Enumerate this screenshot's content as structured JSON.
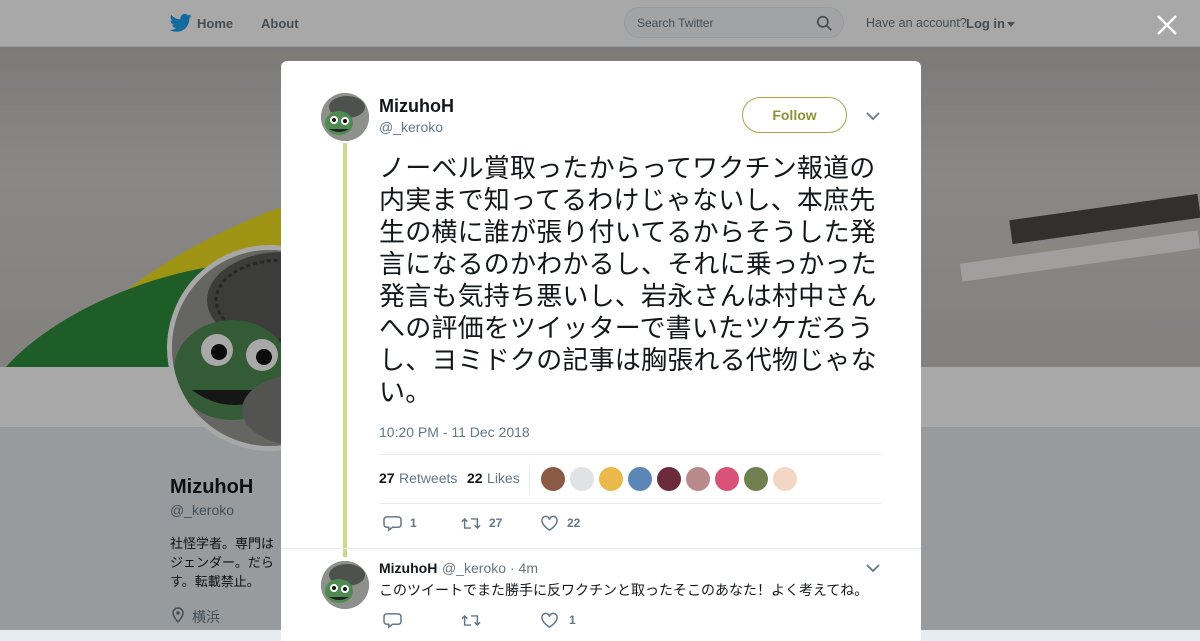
{
  "nav": {
    "home_label": "Home",
    "about_label": "About",
    "search_placeholder": "Search Twitter",
    "have_account": "Have an account?",
    "login_label": "Log in"
  },
  "background_profile": {
    "name": "MizuhoH",
    "handle": "@_keroko",
    "bio": "社怪学者。専門は　　　ジェンダー。だら　　　す。転載禁止。",
    "location": "横浜"
  },
  "tweet": {
    "name": "MizuhoH",
    "handle": "@_keroko",
    "follow_label": "Follow",
    "text": "ノーベル賞取ったからってワクチン報道の内実まで知ってるわけじゃないし、本庶先生の横に誰が張り付いてるからそうした発言になるのかわかるし、それに乗っかった発言も気持ち悪いし、岩永さんは村中さんへの評価をツイッターで書いたツケだろうし、ヨミドクの記事は胸張れる代物じゃない。",
    "timestamp": "10:20 PM - 11 Dec 2018",
    "retweets_count": "27",
    "retweets_label": "Retweets",
    "likes_count": "22",
    "likes_label": "Likes",
    "liker_avatars": [
      "#8a5a44",
      "#dfe3e6",
      "#e9b949",
      "#5b86b7",
      "#6b2b3a",
      "#b98a8a",
      "#d8527a",
      "#6f7f4f",
      "#f2d7c4"
    ],
    "reply_count": "1",
    "retweet_count": "27",
    "like_count": "22"
  },
  "reply": {
    "name": "MizuhoH",
    "handle": "@_keroko",
    "time": "· 4m",
    "text": "このツイートでまた勝手に反ワクチンと取ったそこのあなた！よく考えてね。",
    "reply_count": "",
    "retweet_count": "",
    "like_count": "1"
  },
  "colors": {
    "follow_accent": "#a3a949",
    "thread_line": "#cfd68f",
    "twitter_blue": "#1da1f2"
  }
}
